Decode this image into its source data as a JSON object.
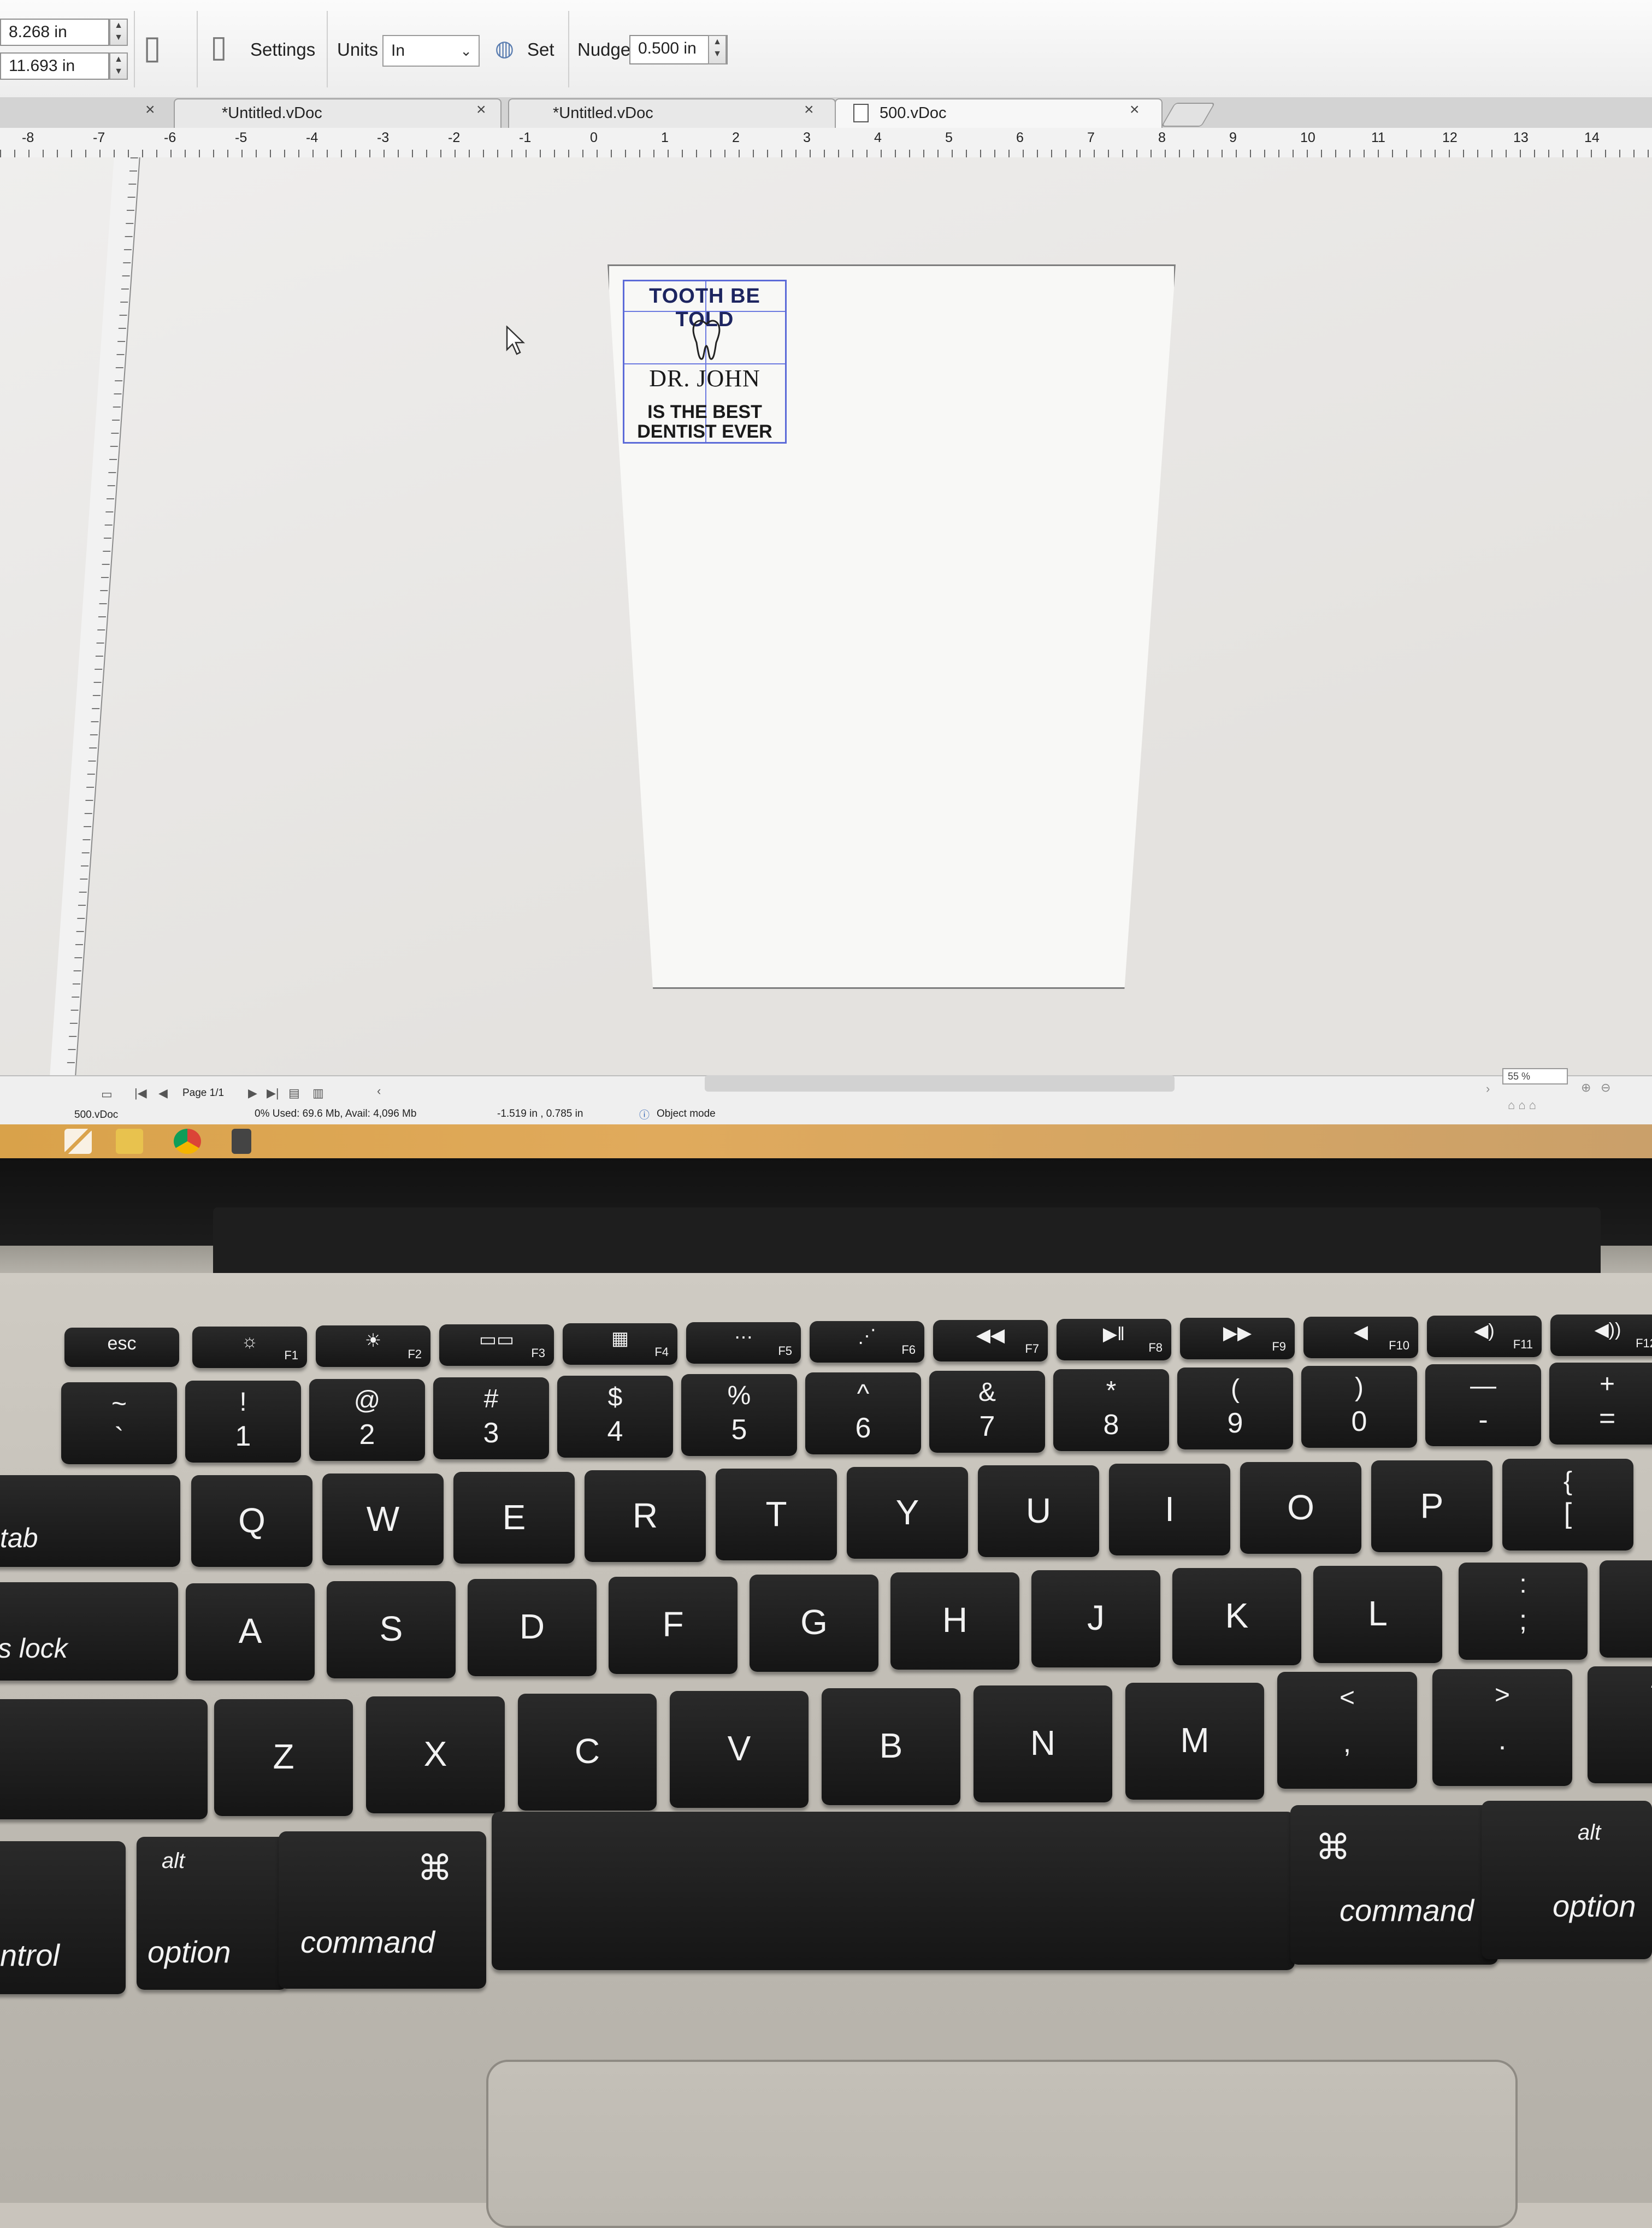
{
  "toolbar": {
    "width_value": "8.268 in",
    "height_value": "11.693 in",
    "settings_label": "Settings",
    "units_label": "Units",
    "units_value": "In",
    "set_label": "Set",
    "nudge_label": "Nudge",
    "nudge_value": "0.500 in"
  },
  "tabs": [
    {
      "label": "*Untitled.vDoc"
    },
    {
      "label": "*Untitled.vDoc"
    },
    {
      "label": "500.vDoc"
    }
  ],
  "ruler_numbers": [
    "-8",
    "-7",
    "-6",
    "-5",
    "-4",
    "-3",
    "-2",
    "-1",
    "0",
    "1",
    "2",
    "3",
    "4",
    "5",
    "6",
    "7",
    "8",
    "9",
    "10",
    "11",
    "12",
    "13",
    "14"
  ],
  "label_design": {
    "title": "TOOTH BE TOLD",
    "name": "DR. JOHN",
    "line1": "IS THE BEST",
    "line2": "DENTIST EVER"
  },
  "status": {
    "page": "Page 1/1",
    "file": "500.vDoc",
    "memory": "0%  Used: 69.6 Mb, Avail: 4,096 Mb",
    "coords": "-1.519 in , 0.785 in",
    "mode": "Object mode",
    "zoom": "55 %"
  },
  "keyboard": {
    "esc": "esc",
    "f_labels": [
      "F1",
      "F2",
      "F3",
      "F4",
      "F5",
      "F6",
      "F7",
      "F8",
      "F9",
      "F10",
      "F11",
      "F12"
    ],
    "number_row": [
      {
        "u": "~",
        "l": "`"
      },
      {
        "u": "!",
        "l": "1"
      },
      {
        "u": "@",
        "l": "2"
      },
      {
        "u": "#",
        "l": "3"
      },
      {
        "u": "$",
        "l": "4"
      },
      {
        "u": "%",
        "l": "5"
      },
      {
        "u": "^",
        "l": "6"
      },
      {
        "u": "&",
        "l": "7"
      },
      {
        "u": "*",
        "l": "8"
      },
      {
        "u": "(",
        "l": "9"
      },
      {
        "u": ")",
        "l": "0"
      },
      {
        "u": "—",
        "l": "-"
      },
      {
        "u": "+",
        "l": "="
      }
    ],
    "row_q": [
      "Q",
      "W",
      "E",
      "R",
      "T",
      "Y",
      "U",
      "I",
      "O",
      "P"
    ],
    "row_q_extra": {
      "u": "{",
      "l": "["
    },
    "row_a": [
      "A",
      "S",
      "D",
      "F",
      "G",
      "H",
      "J",
      "K",
      "L"
    ],
    "row_a_extra": [
      {
        "u": ":",
        "l": ";"
      },
      {
        "u": "\"",
        "l": "'"
      }
    ],
    "row_z": [
      "Z",
      "X",
      "C",
      "V",
      "B",
      "N",
      "M"
    ],
    "row_z_extra": [
      {
        "u": "<",
        "l": ","
      },
      {
        "u": ">",
        "l": "."
      },
      {
        "u": "?",
        "l": "/"
      }
    ],
    "tab": "tab",
    "caps": "s lock",
    "control": "ntrol",
    "option_left": "option",
    "alt_left": "alt",
    "command_left": "command",
    "cmd_symbol": "⌘",
    "command_right": "command",
    "option_right": "option",
    "alt_right": "alt"
  },
  "colors": {
    "label_border": "#5c6bd8",
    "taskbar": "#e0aa5c",
    "key": "#1a1a1a"
  }
}
